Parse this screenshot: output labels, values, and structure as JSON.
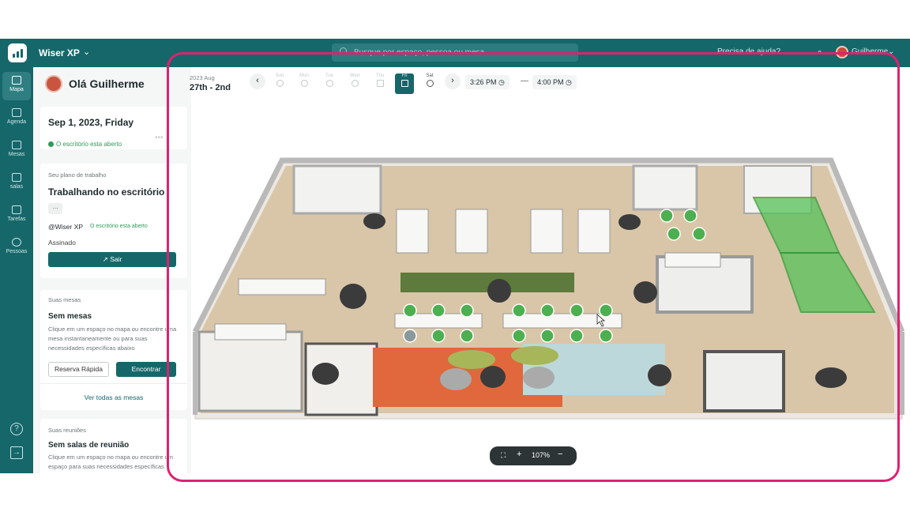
{
  "app": {
    "name": "Wiser XP",
    "help": "Precisa de ajuda?",
    "user": "Guilherme"
  },
  "search": {
    "placeholder": "Busque por espaço, pessoa ou mesa"
  },
  "rail": [
    {
      "label": "Mapa",
      "icon": "home-icon",
      "active": true
    },
    {
      "label": "Agenda",
      "icon": "calendar-icon"
    },
    {
      "label": "Mesas",
      "icon": "desk-icon"
    },
    {
      "label": "salas",
      "icon": "room-icon"
    },
    {
      "label": "Tarefas",
      "icon": "tasks-icon"
    },
    {
      "label": "Pessoas",
      "icon": "people-icon"
    }
  ],
  "panel": {
    "greeting": "Olá Guilherme",
    "date_card": {
      "date": "Sep 1, 2023, Friday",
      "status": "O escritório esta aberto"
    },
    "plan": {
      "heading": "Seu plano de trabalho",
      "title": "Trabalhando no escritório",
      "org": "@Wiser XP",
      "org_status": "O escritório esta aberto",
      "signed": "Assinado",
      "leave": "Sair"
    },
    "desks": {
      "heading": "Suas mesas",
      "title": "Sem mesas",
      "desc": "Clique em um espaço no mapa ou encontre uma mesa instantaneamente ou para suas necessidades específicas abaixo",
      "quick": "Reserva Rápida",
      "find": "Encontrar",
      "see_all": "Ver todas as mesas"
    },
    "meetings": {
      "heading": "Suas reuniões",
      "title": "Sem salas de reunião",
      "desc": "Clique em um espaço no mapa ou encontre um espaço para suas necessidades específicas"
    }
  },
  "datebar": {
    "year": "2023 Aug",
    "range": "27th - 2nd",
    "days": [
      "Sun",
      "Mon",
      "Tue",
      "Wed",
      "Thu",
      "Fri",
      "Sat"
    ],
    "active_day": "Fri",
    "start": "3:26 PM",
    "end": "4:00 PM"
  },
  "zoom": {
    "level": "107%"
  },
  "colors": {
    "primary": "#16676a",
    "accent": "#e0206f",
    "booked": "#4caf50"
  }
}
